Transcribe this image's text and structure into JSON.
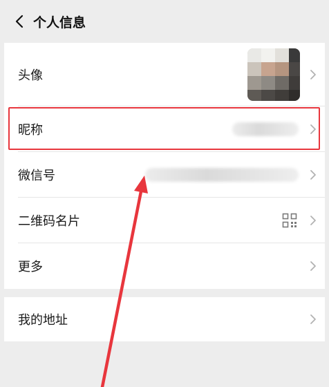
{
  "nav": {
    "title": "个人信息",
    "back_icon": "chevron-left-icon"
  },
  "rows": {
    "avatar": {
      "label": "头像"
    },
    "nickname": {
      "label": "昵称"
    },
    "wechat_id": {
      "label": "微信号"
    },
    "qr_card": {
      "label": "二维码名片",
      "icon": "qr-code-icon"
    },
    "more": {
      "label": "更多"
    },
    "address": {
      "label": "我的地址"
    }
  },
  "annotation": {
    "highlight_color": "#e8363d",
    "target": "昵称"
  }
}
